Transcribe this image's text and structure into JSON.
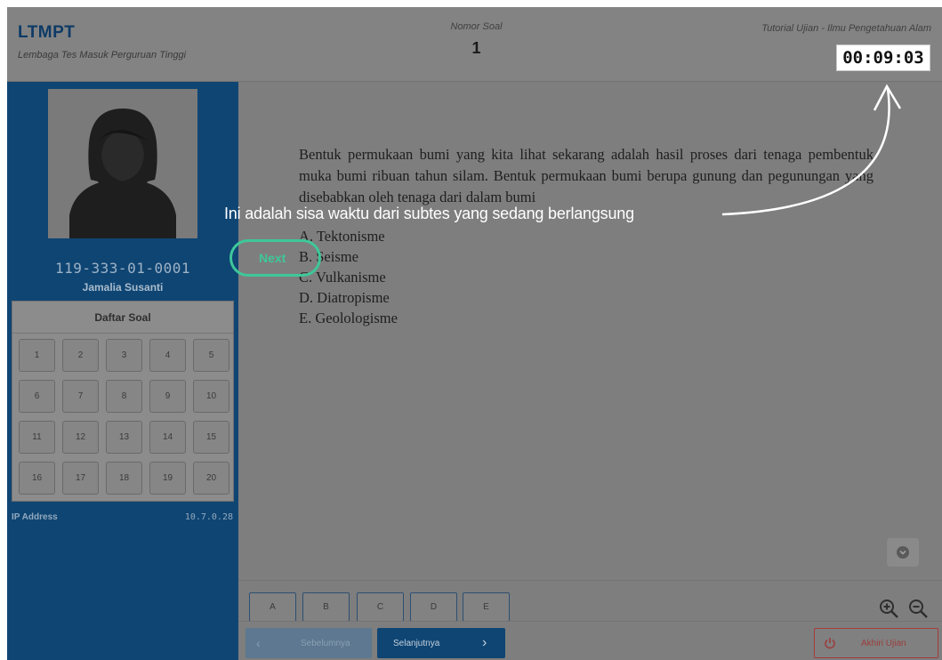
{
  "header": {
    "brand": "LTMPT",
    "subtitle": "Lembaga Tes Masuk Perguruan Tinggi",
    "question_number_label": "Nomor Soal",
    "question_number": "1",
    "tutorial_label": "Tutorial Ujian - Ilmu Pengetahuan Alam",
    "timer": "00:09:03"
  },
  "sidebar": {
    "avatar_icon": "user-silhouette-icon",
    "participant_id": "119-333-01-0001",
    "participant_name": "Jamalia Susanti",
    "daftar_title": "Daftar Soal",
    "questions": [
      "1",
      "2",
      "3",
      "4",
      "5",
      "6",
      "7",
      "8",
      "9",
      "10",
      "11",
      "12",
      "13",
      "14",
      "15",
      "16",
      "17",
      "18",
      "19",
      "20"
    ],
    "ip_label": "IP Address",
    "ip_value": "10.7.0.28"
  },
  "question": {
    "text": "Bentuk permukaan bumi yang kita lihat sekarang adalah hasil proses dari tenaga pembentuk muka bumi ribuan tahun silam. Bentuk permukaan bumi berupa gunung dan pegunungan yang disebabkan oleh tenaga dari dalam bumi",
    "options": [
      "A. Tektonisme",
      "B. Seisme",
      "C. Vulkanisme",
      "D. Diatropisme",
      "E. Geolologisme"
    ]
  },
  "overlay": {
    "annotation": "Ini adalah sisa waktu dari subtes yang sedang berlangsung",
    "next_label": "Next"
  },
  "answers": [
    "A",
    "B",
    "C",
    "D",
    "E"
  ],
  "nav": {
    "prev_label": "Sebelumnya",
    "next_label": "Selanjutnya",
    "finish_label": "Akhiri Ujian"
  },
  "colors": {
    "sidebar": "#0f4573",
    "overlay_gray": "#7e7e7e",
    "tutorial_green": "#3ec79a",
    "finish_red": "#a33c3c"
  }
}
